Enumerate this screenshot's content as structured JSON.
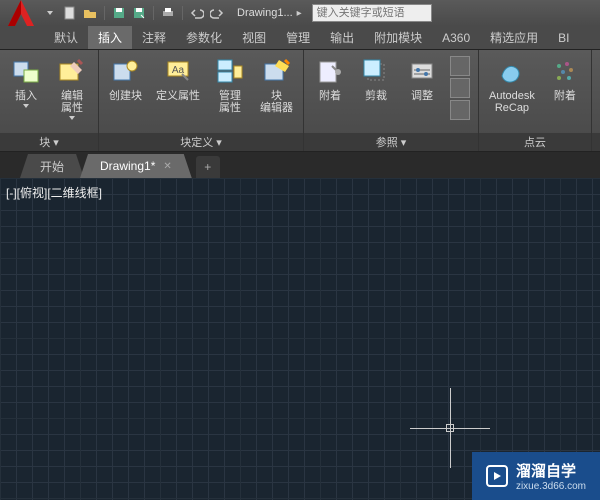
{
  "app": {
    "title": "Drawing1...",
    "search_placeholder": "键入关键字或短语"
  },
  "menu": {
    "tabs": [
      "默认",
      "插入",
      "注释",
      "参数化",
      "视图",
      "管理",
      "输出",
      "附加模块",
      "A360",
      "精选应用",
      "BI"
    ],
    "active": 1
  },
  "ribbon": {
    "panels": [
      {
        "title": "块 ▾",
        "buttons": [
          {
            "label": "插入",
            "icon": "insert-block"
          },
          {
            "label": "编辑\n属性",
            "icon": "edit-attr"
          }
        ]
      },
      {
        "title": "块定义 ▾",
        "buttons": [
          {
            "label": "创建块",
            "icon": "create-block"
          },
          {
            "label": "定义属性",
            "icon": "define-attr"
          },
          {
            "label": "管理\n属性",
            "icon": "manage-attr"
          },
          {
            "label": "块\n编辑器",
            "icon": "block-editor"
          }
        ]
      },
      {
        "title": "参照 ▾",
        "buttons": [
          {
            "label": "附着",
            "icon": "attach"
          },
          {
            "label": "剪裁",
            "icon": "clip"
          },
          {
            "label": "调整",
            "icon": "adjust"
          }
        ]
      },
      {
        "title": "点云",
        "buttons": [
          {
            "label": "Autodesk\nReCap",
            "icon": "recap"
          },
          {
            "label": "附着",
            "icon": "attach-cloud"
          }
        ]
      }
    ]
  },
  "doctabs": {
    "tabs": [
      {
        "label": "开始",
        "active": false
      },
      {
        "label": "Drawing1*",
        "active": true
      }
    ]
  },
  "canvas": {
    "viewlabel": "[-][俯视][二维线框]"
  },
  "watermark": {
    "brand": "溜溜自学",
    "url": "zixue.3d66.com"
  }
}
